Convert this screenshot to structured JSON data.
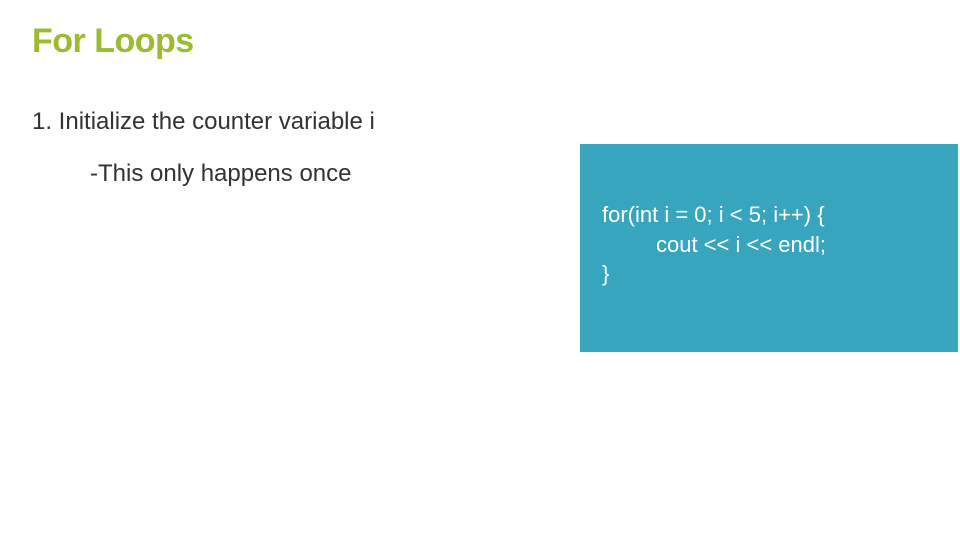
{
  "title": "For Loops",
  "step": "1. Initialize the counter variable i",
  "substep": "-This only happens once",
  "code": {
    "line1": "for(int i = 0; i < 5; i++) {",
    "line2": "cout << i << endl;",
    "line3": "}"
  }
}
